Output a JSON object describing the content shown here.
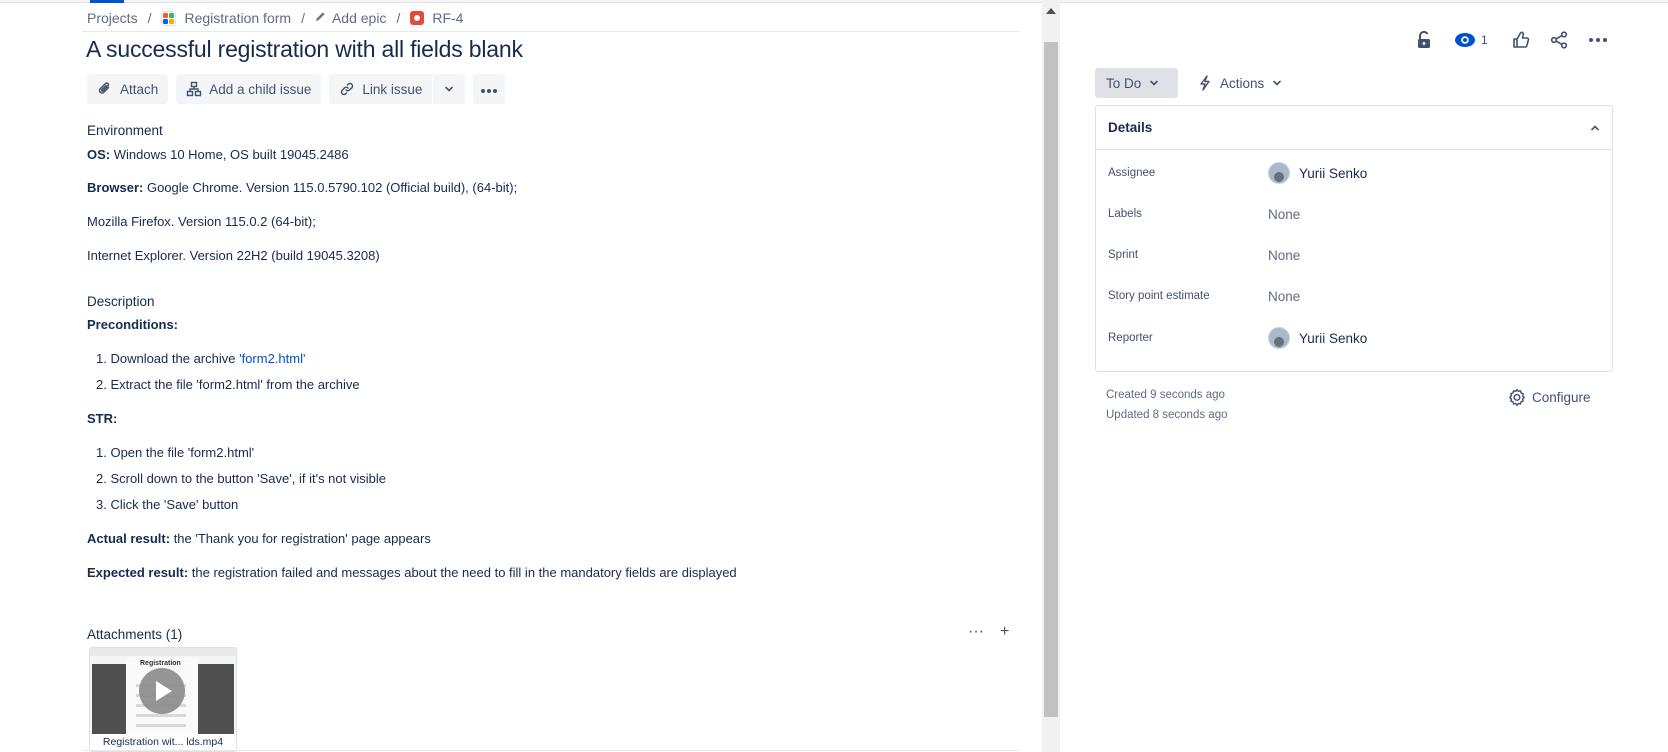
{
  "breadcrumb": {
    "projects": "Projects",
    "project": "Registration form",
    "epic": "Add epic",
    "issue_key": "RF-4",
    "separator": "/"
  },
  "issue": {
    "title": "A successful registration with all fields blank"
  },
  "toolbar": {
    "attach": "Attach",
    "add_child": "Add a child issue",
    "link_issue": "Link issue"
  },
  "environment": {
    "heading": "Environment",
    "os_label": "OS:",
    "os_value": " Windows 10 Home, OS built 19045.2486",
    "browser_label": "Browser:",
    "browser_value": " Google Chrome. Version 115.0.5790.102 (Official build), (64-bit);",
    "firefox": "Mozilla Firefox. Version 115.0.2 (64-bit);",
    "ie": "Internet Explorer. Version 22H2 (build 19045.3208)"
  },
  "description": {
    "heading": "Description",
    "preconditions_label": "Preconditions:",
    "preconditions": {
      "step1_prefix": "1. Download the archive ",
      "step1_link": "'form2.html'",
      "step2": "2. Extract the file 'form2.html' from the archive"
    },
    "str_label": "STR:",
    "steps": [
      "1. Open the file 'form2.html'",
      "2. Scroll down to the button 'Save', if it's not visible",
      "3. Click the 'Save' button"
    ],
    "actual_label": "Actual result:",
    "actual_value": " the 'Thank you for registration' page appears",
    "expected_label": "Expected result:",
    "expected_value": " the registration failed and messages about the need to fill in the mandatory fields are displayed"
  },
  "attachments": {
    "heading": "Attachments (1)",
    "more_glyph": "···",
    "add_glyph": "+",
    "file_name": "Registration wit... lds.mp4",
    "thumb_caption": "Registration"
  },
  "sidebar": {
    "watch_count": "1",
    "status": "To Do",
    "actions": "Actions",
    "details_heading": "Details",
    "fields": [
      {
        "label": "Assignee",
        "value": "Yurii Senko"
      },
      {
        "label": "Labels",
        "value": "None"
      },
      {
        "label": "Sprint",
        "value": "None"
      },
      {
        "label": "Story point estimate",
        "value": "None"
      },
      {
        "label": "Reporter",
        "value": "Yurii Senko"
      }
    ],
    "created": "Created 9 seconds ago",
    "updated": "Updated 8 seconds ago",
    "configure": "Configure"
  },
  "colors": {
    "link": "#0052cc",
    "text": "#172b4d",
    "bug_icon": "#e5493a",
    "watch_icon": "#0052cc"
  },
  "icons": [
    "paperclip-icon",
    "child-issue-icon",
    "link-icon",
    "chevron-down-icon",
    "more-icon",
    "lock-icon",
    "eye-icon",
    "thumbs-up-icon",
    "share-icon",
    "lightning-icon",
    "chevron-up-icon",
    "gear-icon",
    "play-icon"
  ]
}
